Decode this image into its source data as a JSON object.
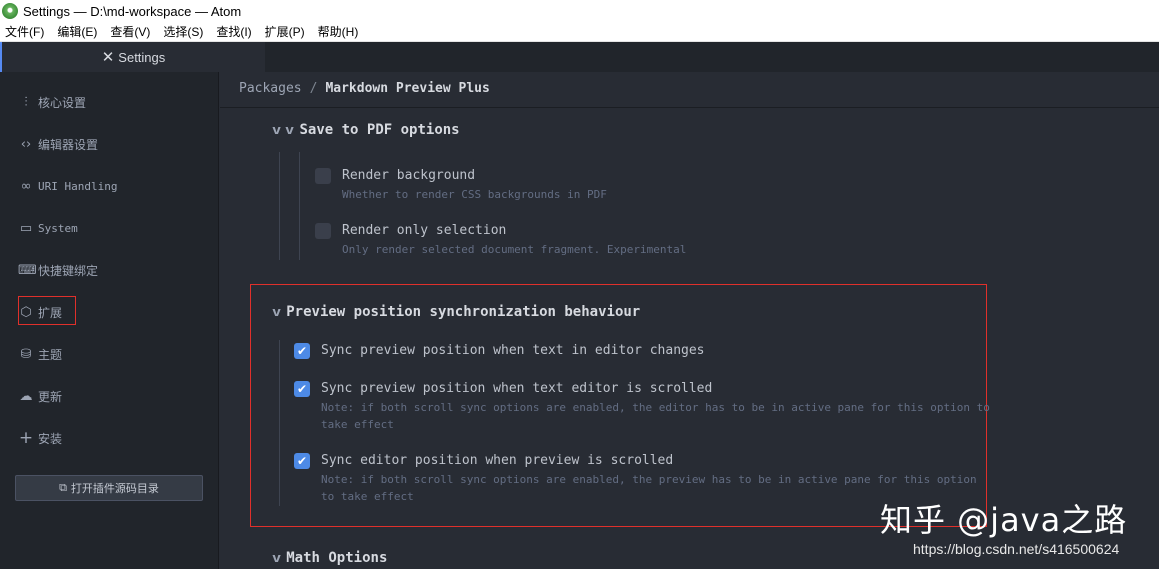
{
  "window": {
    "title": "Settings — D:\\md-workspace — Atom"
  },
  "menu": [
    "文件(F)",
    "编辑(E)",
    "查看(V)",
    "选择(S)",
    "查找(I)",
    "扩展(P)",
    "帮助(H)"
  ],
  "tab": {
    "label": "Settings",
    "icon": "tools-icon"
  },
  "sidebar": {
    "items": [
      {
        "label": "核心设置",
        "icon": "sliders-icon"
      },
      {
        "label": "编辑器设置",
        "icon": "code-icon"
      },
      {
        "label": "URI Handling",
        "icon": "link-icon"
      },
      {
        "label": "System",
        "icon": "monitor-icon"
      },
      {
        "label": "快捷键绑定",
        "icon": "keyboard-icon"
      },
      {
        "label": "扩展",
        "icon": "package-icon"
      },
      {
        "label": "主题",
        "icon": "paintcan-icon"
      },
      {
        "label": "更新",
        "icon": "cloud-download-icon"
      },
      {
        "label": "安装",
        "icon": "plus-icon"
      }
    ],
    "open_button": "打开插件源码目录",
    "highlight_color": "#e0302b"
  },
  "breadcrumb": {
    "root": "Packages",
    "separator": "/",
    "current": "Markdown Preview Plus"
  },
  "sections": {
    "pdf": {
      "title": "Save to PDF options",
      "options": [
        {
          "label": "Render background",
          "desc": "Whether to render CSS backgrounds in PDF",
          "checked": false
        },
        {
          "label": "Render only selection",
          "desc": "Only render selected document fragment. Experimental",
          "checked": false
        }
      ]
    },
    "sync": {
      "title": "Preview position synchronization behaviour",
      "options": [
        {
          "label": "Sync preview position when text in editor changes",
          "desc": "",
          "checked": true
        },
        {
          "label": "Sync preview position when text editor is scrolled",
          "desc": "Note: if both scroll sync options are enabled, the editor has to be in active pane for this option to\ntake effect",
          "checked": true
        },
        {
          "label": "Sync editor position when preview is scrolled",
          "desc": "Note: if both scroll sync options are enabled, the preview has to be in active pane for this option\nto take effect",
          "checked": true
        }
      ]
    },
    "math": {
      "title": "Math Options"
    }
  },
  "overlay": {
    "watermark": "知乎 @java之路",
    "url": "https://blog.csdn.net/s416500624"
  },
  "colors": {
    "accent": "#4d8ae6",
    "highlight": "#e0302b",
    "background": "#282c34",
    "sidebar": "#21252b"
  }
}
